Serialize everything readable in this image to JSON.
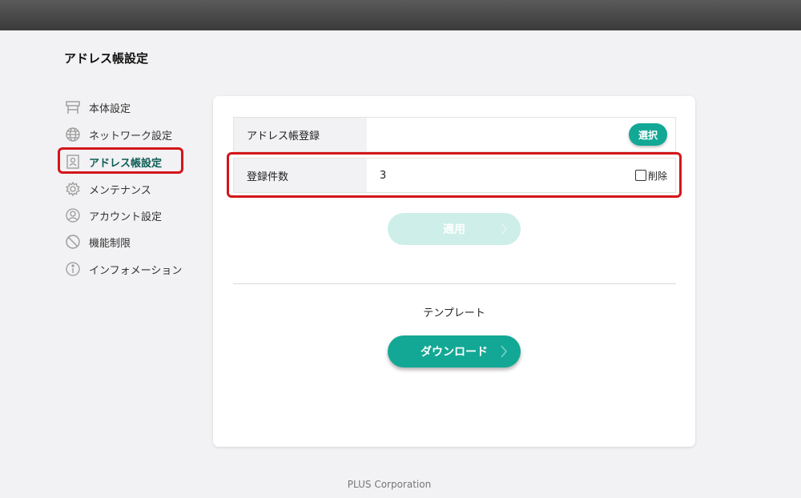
{
  "page_title": "アドレス帳設定",
  "sidebar": {
    "items": [
      {
        "label": "本体設定",
        "icon": "printer-stand-icon"
      },
      {
        "label": "ネットワーク設定",
        "icon": "globe-icon"
      },
      {
        "label": "アドレス帳設定",
        "icon": "address-book-icon",
        "active": true
      },
      {
        "label": "メンテナンス",
        "icon": "gear-icon"
      },
      {
        "label": "アカウント設定",
        "icon": "user-circle-icon"
      },
      {
        "label": "機能制限",
        "icon": "prohibited-icon"
      },
      {
        "label": "インフォメーション",
        "icon": "info-icon"
      }
    ]
  },
  "form": {
    "register_label": "アドレス帳登録",
    "select_button": "選択",
    "count_label": "登録件数",
    "count_value": "3",
    "delete_label": "削除",
    "delete_checked": false
  },
  "apply_button": "適用",
  "template_label": "テンプレート",
  "download_button": "ダウンロード",
  "footer": "PLUS Corporation",
  "colors": {
    "accent": "#13a895",
    "accent_disabled": "#cdeee9",
    "highlight": "#d3151a",
    "active_text": "#0f5e56"
  }
}
